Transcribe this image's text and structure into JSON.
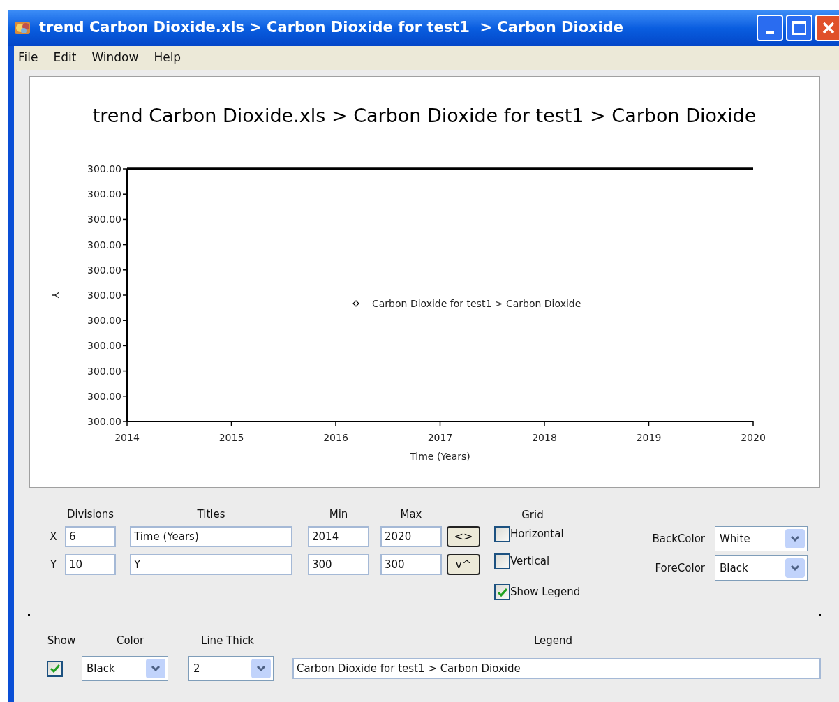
{
  "window": {
    "title": "trend Carbon Dioxide.xls > Carbon Dioxide for test1  > Carbon Dioxide"
  },
  "menu": [
    "File",
    "Edit",
    "Window",
    "Help"
  ],
  "chart": {
    "title": "trend Carbon Dioxide.xls > Carbon Dioxide for test1 > Carbon Dioxide",
    "xlabel": "Time (Years)",
    "ylabel": "Y",
    "legend": "Carbon Dioxide for test1 > Carbon Dioxide",
    "x_tick_labels": [
      "2014",
      "2015",
      "2016",
      "2017",
      "2018",
      "2019",
      "2020"
    ],
    "y_tick_labels": [
      "300.00",
      "300.00",
      "300.00",
      "300.00",
      "300.00",
      "300.00",
      "300.00",
      "300.00",
      "300.00",
      "300.00",
      "300.00"
    ]
  },
  "axis_settings": {
    "headers": {
      "divisions": "Divisions",
      "titles": "Titles",
      "min": "Min",
      "max": "Max"
    },
    "rows": [
      {
        "axis": "X",
        "divisions": "6",
        "title": "Time (Years)",
        "min": "2014",
        "max": "2020",
        "swap_button": "<>"
      },
      {
        "axis": "Y",
        "divisions": "10",
        "title": "Y",
        "min": "300",
        "max": "300",
        "swap_button": "v^"
      }
    ]
  },
  "grid": {
    "label": "Grid",
    "options": [
      {
        "label": "Horizontal",
        "checked": false
      },
      {
        "label": "Vertical",
        "checked": false
      }
    ]
  },
  "show_legend": {
    "label": "Show Legend",
    "checked": true
  },
  "colors": [
    {
      "label": "BackColor",
      "value": "White"
    },
    {
      "label": "ForeColor",
      "value": "Black"
    }
  ],
  "series_settings": {
    "headers": {
      "show": "Show",
      "line_color": "Color",
      "line_thick": "Line Thick",
      "legend": "Legend"
    },
    "rows": [
      {
        "show": true,
        "line_color": "Black",
        "line_thick": "2",
        "legend": "Carbon Dioxide for test1 > Carbon Dioxide"
      }
    ]
  }
}
